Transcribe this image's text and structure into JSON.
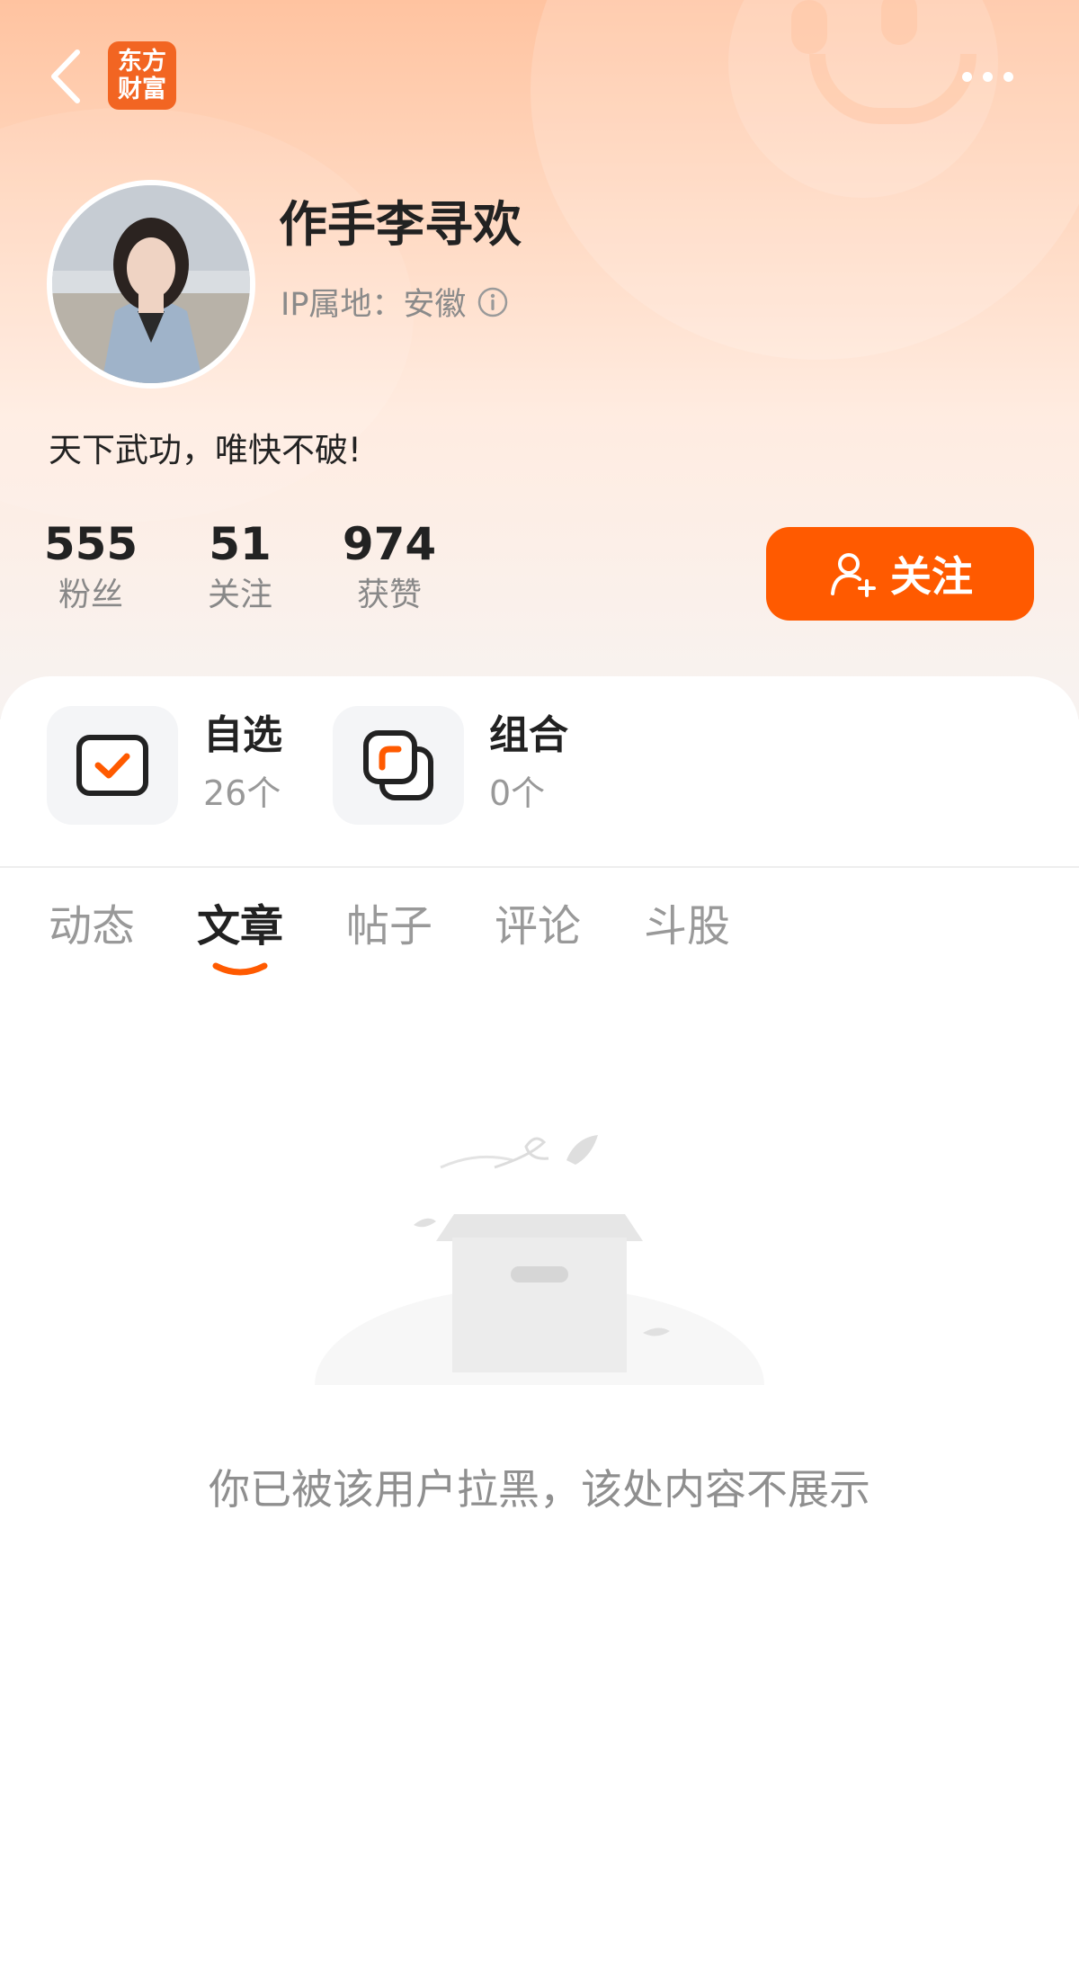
{
  "header": {
    "app_logo_text": "东方\n财富"
  },
  "profile": {
    "name": "作手李寻欢",
    "ip_location": "IP属地：安徽",
    "bio": "天下武功，唯快不破!"
  },
  "stats": [
    {
      "value": "555",
      "label": "粉丝"
    },
    {
      "value": "51",
      "label": "关注"
    },
    {
      "value": "974",
      "label": "获赞"
    }
  ],
  "follow_button": {
    "label": "关注"
  },
  "shortcuts": [
    {
      "title": "自选",
      "count": "26个"
    },
    {
      "title": "组合",
      "count": "0个"
    }
  ],
  "tabs": [
    {
      "label": "动态",
      "active": false
    },
    {
      "label": "文章",
      "active": true
    },
    {
      "label": "帖子",
      "active": false
    },
    {
      "label": "评论",
      "active": false
    },
    {
      "label": "斗股",
      "active": false
    }
  ],
  "empty_state": {
    "message": "你已被该用户拉黑，该处内容不展示"
  },
  "colors": {
    "accent": "#ff5a00",
    "brand": "#f26522",
    "hero_top": "#ffc3a0"
  }
}
